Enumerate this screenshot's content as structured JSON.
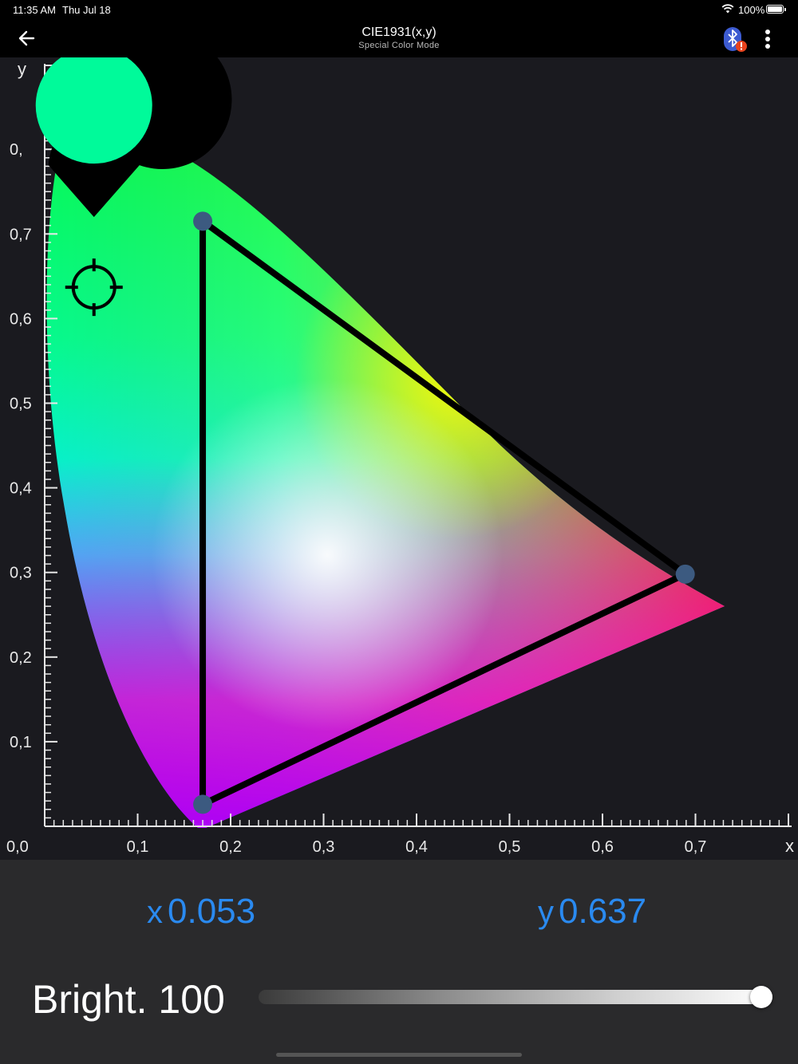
{
  "status_bar": {
    "time": "11:35 AM",
    "date": "Thu Jul 18",
    "battery_percent": "100%",
    "battery_level": 1.0
  },
  "nav": {
    "title": "CIE1931(x,y)",
    "subtitle": "Special Color Mode",
    "icons": [
      "back-arrow-icon",
      "bluetooth-warning-icon",
      "more-vertical-icon"
    ]
  },
  "chart": {
    "y_axis_label": "y",
    "x_axis_label": "x",
    "origin_label": "0,0",
    "y_ticks": [
      "0,1",
      "0,2",
      "0,3",
      "0,4",
      "0,5",
      "0,6",
      "0,7",
      "0,"
    ],
    "x_ticks": [
      "0,1",
      "0,2",
      "0,3",
      "0,4",
      "0,5",
      "0,6",
      "0,7"
    ],
    "gamut_triangle": [
      {
        "x": 0.17,
        "y": 0.715
      },
      {
        "x": 0.689,
        "y": 0.298
      },
      {
        "x": 0.17,
        "y": 0.026
      }
    ],
    "selected_point": {
      "x": 0.053,
      "y": 0.637
    },
    "selected_color": "#00fa9a",
    "icons": [
      "color-marker-pin-icon",
      "crosshair-icon"
    ]
  },
  "controls": {
    "x_label": "x",
    "x_value": "0.053",
    "y_label": "y",
    "y_value": "0.637",
    "brightness_label": "Bright.",
    "brightness_value": "100",
    "brightness_level": 1.0,
    "accent_color": "#2a8af0"
  }
}
